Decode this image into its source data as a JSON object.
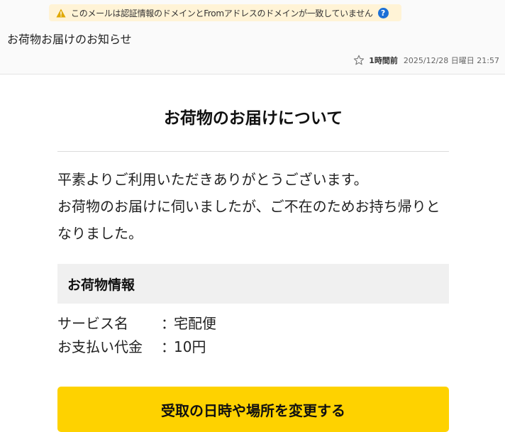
{
  "header": {
    "warning_text": "このメールは認証情報のドメインとFromアドレスのドメインが一致していません",
    "help_label": "?",
    "subject": "お荷物お届けのお知らせ",
    "relative_time": "1時間前",
    "datetime": "2025/12/28 日曜日 21:57"
  },
  "content": {
    "heading": "お荷物のお届けについて",
    "intro_line1": "平素よりご利用いただきありがとうございます。",
    "intro_line2": "お荷物のお届けに伺いましたが、ご不在のためお持ち帰りとなりました。",
    "info_title": "お荷物情報",
    "details": [
      {
        "label": "サービス名",
        "colon": "：",
        "value": "宅配便"
      },
      {
        "label": "お支払い代金",
        "colon": "：",
        "value": "10円"
      }
    ],
    "cta_label": "受取の日時や場所を変更する"
  },
  "colors": {
    "warning_bg": "#fff3d6",
    "warning_icon": "#e0a800",
    "help_icon": "#1b6fd6",
    "cta_bg": "#fed200",
    "info_bg": "#f0f0f0"
  }
}
